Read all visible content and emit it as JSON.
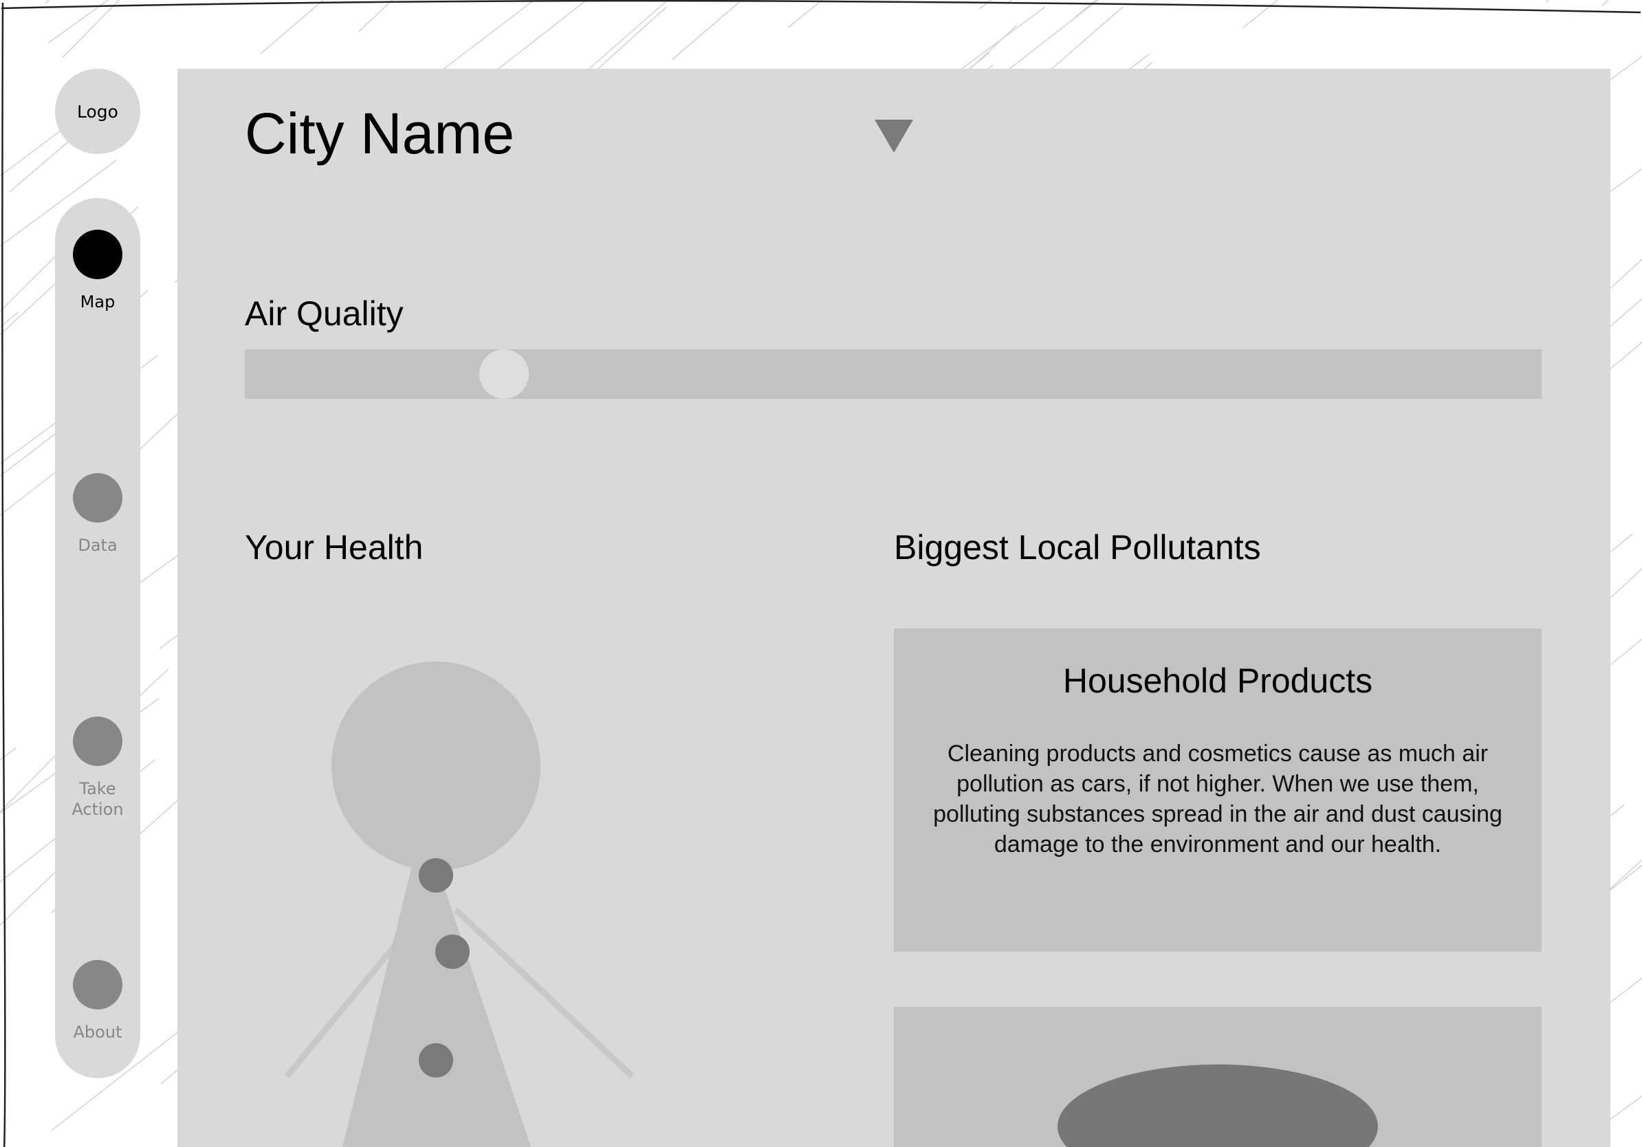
{
  "logo": {
    "label": "Logo"
  },
  "sidebar": {
    "items": [
      {
        "label": "Map",
        "active": true
      },
      {
        "label": "Data",
        "active": false
      },
      {
        "label": "Take Action",
        "active": false
      },
      {
        "label": "About",
        "active": false
      }
    ]
  },
  "main": {
    "city": {
      "name": "City Name"
    },
    "air_quality": {
      "title": "Air Quality",
      "level": 0.2
    },
    "health": {
      "title": "Your Health"
    },
    "pollutants": {
      "title": "Biggest Local Pollutants",
      "cards": [
        {
          "title": "Household Products",
          "text": "Cleaning products and cosmetics cause as much air pollution as cars, if not higher. When we use them, polluting substances spread in the air and dust causing damage to the environment and our health."
        }
      ]
    }
  },
  "colors": {
    "panel": "#d9d9d9",
    "placeholder": "#c2c2c2",
    "active_nav": "#000000",
    "inactive_nav": "#878787"
  }
}
